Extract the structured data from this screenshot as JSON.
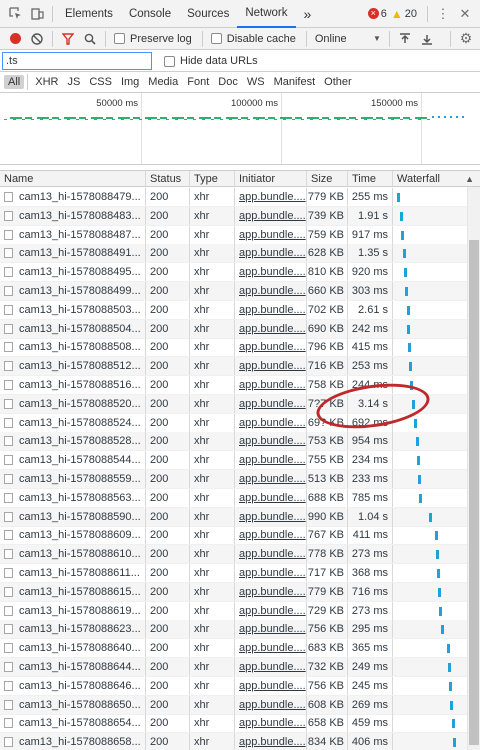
{
  "tabs": [
    "Elements",
    "Console",
    "Sources",
    "Network"
  ],
  "more_tabs": "»",
  "errors": "6",
  "warnings": "20",
  "toolbar": {
    "preserve_log": "Preserve log",
    "disable_cache": "Disable cache",
    "throttle": "Online"
  },
  "filter": {
    "value": ".ts",
    "hide_data": "Hide data URLs"
  },
  "types": [
    "All",
    "XHR",
    "JS",
    "CSS",
    "Img",
    "Media",
    "Font",
    "Doc",
    "WS",
    "Manifest",
    "Other"
  ],
  "overview_ticks": [
    "50000 ms",
    "100000 ms",
    "150000 ms"
  ],
  "columns": [
    "Name",
    "Status",
    "Type",
    "Initiator",
    "Size",
    "Time",
    "Waterfall"
  ],
  "rows": [
    {
      "name": "cam13_hi-1578088479...",
      "status": "200",
      "type": "xhr",
      "initiator": "app.bundle....",
      "size": "779 KB",
      "time": "255 ms",
      "wf": 0.0
    },
    {
      "name": "cam13_hi-1578088483...",
      "status": "200",
      "type": "xhr",
      "initiator": "app.bundle....",
      "size": "739 KB",
      "time": "1.91 s",
      "wf": 0.05
    },
    {
      "name": "cam13_hi-1578088487...",
      "status": "200",
      "type": "xhr",
      "initiator": "app.bundle....",
      "size": "759 KB",
      "time": "917 ms",
      "wf": 0.07
    },
    {
      "name": "cam13_hi-1578088491...",
      "status": "200",
      "type": "xhr",
      "initiator": "app.bundle....",
      "size": "628 KB",
      "time": "1.35 s",
      "wf": 0.09
    },
    {
      "name": "cam13_hi-1578088495...",
      "status": "200",
      "type": "xhr",
      "initiator": "app.bundle....",
      "size": "810 KB",
      "time": "920 ms",
      "wf": 0.11
    },
    {
      "name": "cam13_hi-1578088499...",
      "status": "200",
      "type": "xhr",
      "initiator": "app.bundle....",
      "size": "660 KB",
      "time": "303 ms",
      "wf": 0.13
    },
    {
      "name": "cam13_hi-1578088503...",
      "status": "200",
      "type": "xhr",
      "initiator": "app.bundle....",
      "size": "702 KB",
      "time": "2.61 s",
      "wf": 0.15
    },
    {
      "name": "cam13_hi-1578088504...",
      "status": "200",
      "type": "xhr",
      "initiator": "app.bundle....",
      "size": "690 KB",
      "time": "242 ms",
      "wf": 0.16
    },
    {
      "name": "cam13_hi-1578088508...",
      "status": "200",
      "type": "xhr",
      "initiator": "app.bundle....",
      "size": "796 KB",
      "time": "415 ms",
      "wf": 0.17
    },
    {
      "name": "cam13_hi-1578088512...",
      "status": "200",
      "type": "xhr",
      "initiator": "app.bundle....",
      "size": "716 KB",
      "time": "253 ms",
      "wf": 0.18
    },
    {
      "name": "cam13_hi-1578088516...",
      "status": "200",
      "type": "xhr",
      "initiator": "app.bundle....",
      "size": "758 KB",
      "time": "244 ms",
      "wf": 0.2
    },
    {
      "name": "cam13_hi-1578088520...",
      "status": "200",
      "type": "xhr",
      "initiator": "app.bundle....",
      "size": "7?7 KB",
      "time": "3.14 s",
      "wf": 0.23
    },
    {
      "name": "cam13_hi-1578088524...",
      "status": "200",
      "type": "xhr",
      "initiator": "app.bundle....",
      "size": "69? KB",
      "time": "692 ms",
      "wf": 0.27
    },
    {
      "name": "cam13_hi-1578088528...",
      "status": "200",
      "type": "xhr",
      "initiator": "app.bundle....",
      "size": "753 KB",
      "time": "954 ms",
      "wf": 0.29
    },
    {
      "name": "cam13_hi-1578088544...",
      "status": "200",
      "type": "xhr",
      "initiator": "app.bundle....",
      "size": "755 KB",
      "time": "234 ms",
      "wf": 0.31
    },
    {
      "name": "cam13_hi-1578088559...",
      "status": "200",
      "type": "xhr",
      "initiator": "app.bundle....",
      "size": "513 KB",
      "time": "233 ms",
      "wf": 0.33
    },
    {
      "name": "cam13_hi-1578088563...",
      "status": "200",
      "type": "xhr",
      "initiator": "app.bundle....",
      "size": "688 KB",
      "time": "785 ms",
      "wf": 0.34
    },
    {
      "name": "cam13_hi-1578088590...",
      "status": "200",
      "type": "xhr",
      "initiator": "app.bundle....",
      "size": "990 KB",
      "time": "1.04 s",
      "wf": 0.5
    },
    {
      "name": "cam13_hi-1578088609...",
      "status": "200",
      "type": "xhr",
      "initiator": "app.bundle....",
      "size": "767 KB",
      "time": "411 ms",
      "wf": 0.6
    },
    {
      "name": "cam13_hi-1578088610...",
      "status": "200",
      "type": "xhr",
      "initiator": "app.bundle....",
      "size": "778 KB",
      "time": "273 ms",
      "wf": 0.61
    },
    {
      "name": "cam13_hi-1578088611...",
      "status": "200",
      "type": "xhr",
      "initiator": "app.bundle....",
      "size": "717 KB",
      "time": "368 ms",
      "wf": 0.62
    },
    {
      "name": "cam13_hi-1578088615...",
      "status": "200",
      "type": "xhr",
      "initiator": "app.bundle....",
      "size": "779 KB",
      "time": "716 ms",
      "wf": 0.64
    },
    {
      "name": "cam13_hi-1578088619...",
      "status": "200",
      "type": "xhr",
      "initiator": "app.bundle....",
      "size": "729 KB",
      "time": "273 ms",
      "wf": 0.66
    },
    {
      "name": "cam13_hi-1578088623...",
      "status": "200",
      "type": "xhr",
      "initiator": "app.bundle....",
      "size": "756 KB",
      "time": "295 ms",
      "wf": 0.68
    },
    {
      "name": "cam13_hi-1578088640...",
      "status": "200",
      "type": "xhr",
      "initiator": "app.bundle....",
      "size": "683 KB",
      "time": "365 ms",
      "wf": 0.78
    },
    {
      "name": "cam13_hi-1578088644...",
      "status": "200",
      "type": "xhr",
      "initiator": "app.bundle....",
      "size": "732 KB",
      "time": "249 ms",
      "wf": 0.8
    },
    {
      "name": "cam13_hi-1578088646...",
      "status": "200",
      "type": "xhr",
      "initiator": "app.bundle....",
      "size": "756 KB",
      "time": "245 ms",
      "wf": 0.81
    },
    {
      "name": "cam13_hi-1578088650...",
      "status": "200",
      "type": "xhr",
      "initiator": "app.bundle....",
      "size": "608 KB",
      "time": "269 ms",
      "wf": 0.83
    },
    {
      "name": "cam13_hi-1578088654...",
      "status": "200",
      "type": "xhr",
      "initiator": "app.bundle....",
      "size": "658 KB",
      "time": "459 ms",
      "wf": 0.86
    },
    {
      "name": "cam13_hi-1578088658...",
      "status": "200",
      "type": "xhr",
      "initiator": "app.bundle....",
      "size": "834 KB",
      "time": "406 ms",
      "wf": 0.88
    }
  ],
  "colors": {
    "accent": "#1a73e8",
    "record": "#d93025",
    "filter": "#d93025",
    "waterfall": "#1fa1da",
    "annotation": "#c0292b"
  }
}
